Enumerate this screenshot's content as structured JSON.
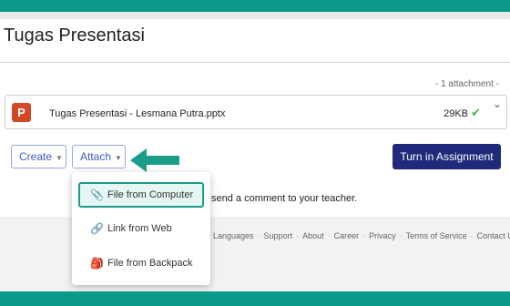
{
  "page": {
    "title": "Tugas Presentasi"
  },
  "attachments": {
    "count_label": "- 1 attachment -",
    "file": {
      "name": "Tugas Presentasi - Lesmana Putra.pptx",
      "size": "29KB",
      "icon": "powerpoint-icon",
      "icon_letter": "P",
      "status_icon": "check-icon"
    }
  },
  "actions": {
    "create_label": "Create",
    "attach_label": "Attach",
    "turnin_label": "Turn in Assignment"
  },
  "attach_menu": {
    "items": [
      {
        "label": "File from Computer",
        "icon": "paperclip-icon",
        "glyph": "📎",
        "highlighted": true
      },
      {
        "label": "Link from Web",
        "icon": "link-icon",
        "glyph": "🔗"
      },
      {
        "label": "File from Backpack",
        "icon": "backpack-icon",
        "glyph": "🎒"
      }
    ]
  },
  "comment_hint": "send a comment to your teacher.",
  "footer": {
    "links": [
      "Languages",
      "Support",
      "About",
      "Career",
      "Privacy",
      "Terms of Service",
      "Contact Us"
    ]
  },
  "colors": {
    "accent": "#0b9a8a",
    "primary_button": "#1f2a7a",
    "highlight_border": "#1a9e89",
    "check": "#4caf50",
    "ppt": "#d24726"
  }
}
